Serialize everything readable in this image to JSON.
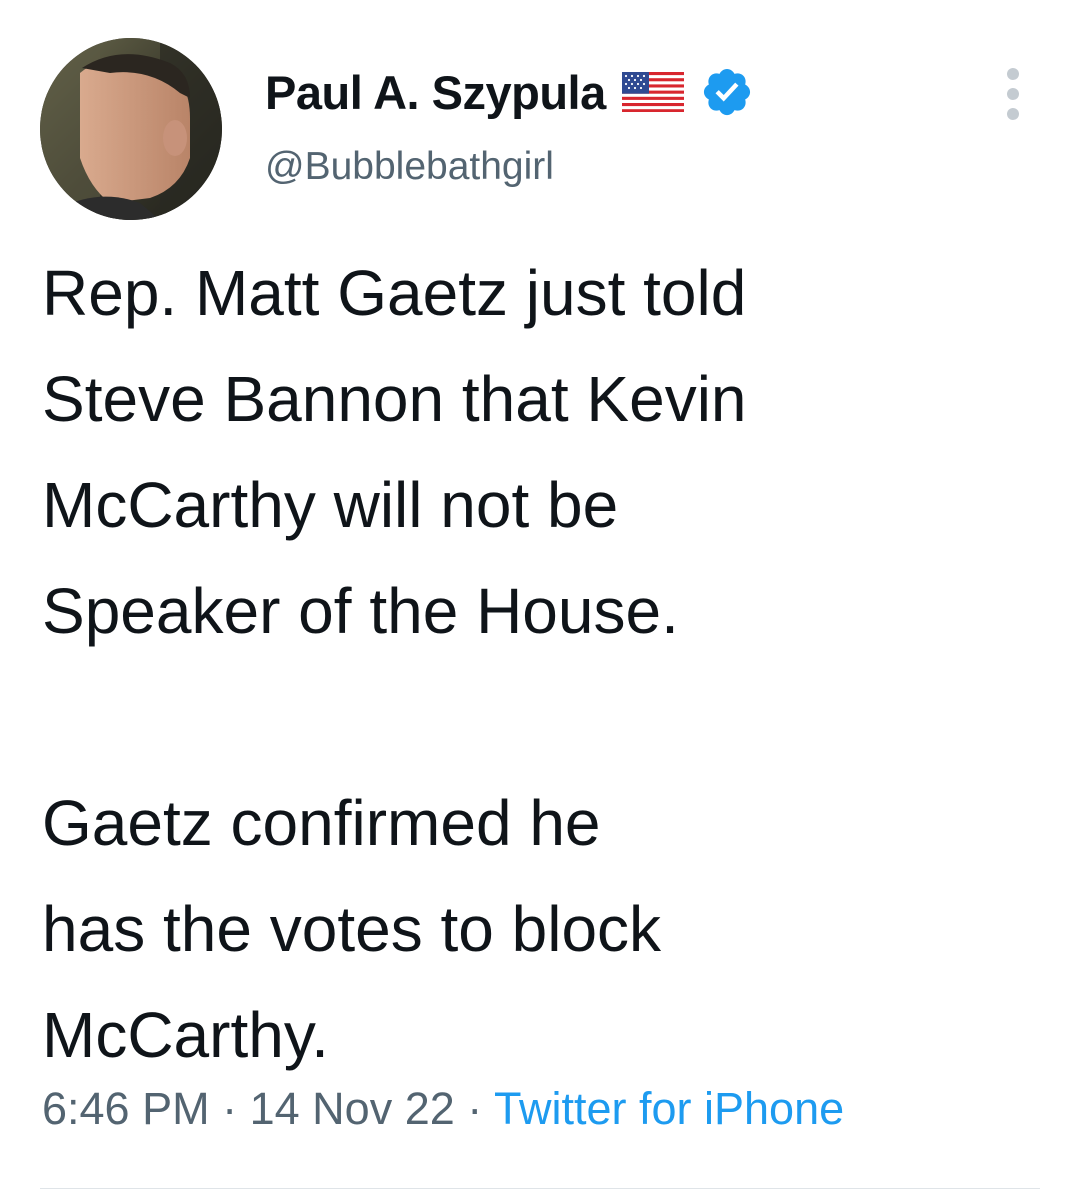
{
  "author": {
    "display_name": "Paul A. Szypula",
    "handle": "@Bubblebathgirl",
    "flag_icon": "us-flag-icon",
    "verified_icon": "verified-badge-icon",
    "verified_color": "#1d9bf0"
  },
  "tweet": {
    "paragraphs": [
      [
        "Rep. Matt Gaetz just told",
        "Steve Bannon that Kevin",
        "McCarthy will not be",
        "Speaker of the House."
      ],
      [
        "Gaetz confirmed he",
        "has the votes to block",
        "McCarthy."
      ]
    ]
  },
  "meta": {
    "time": "6:46 PM",
    "separator": "·",
    "date": "14 Nov 22",
    "source": "Twitter for iPhone"
  },
  "colors": {
    "text_primary": "#0f1419",
    "text_secondary": "#536471",
    "link": "#1d9bf0"
  }
}
